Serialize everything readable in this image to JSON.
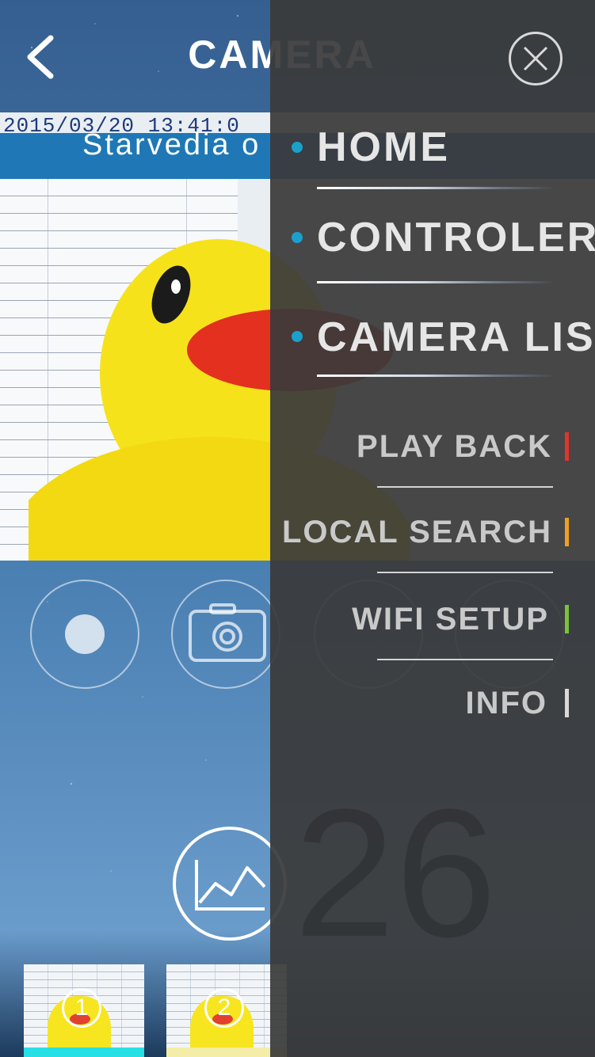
{
  "header": {
    "title": "CAMERA",
    "back_icon": "chevron-left-icon"
  },
  "video": {
    "timestamp": "2015/03/20 13:41:0",
    "caption": "Starvedia o"
  },
  "controls": {
    "record_icon": "record-icon",
    "snapshot_icon": "camera-icon",
    "chart_icon": "line-chart-icon"
  },
  "thumbnails": [
    {
      "number": "1",
      "bar_color": "#27e0e6"
    },
    {
      "number": "2",
      "bar_color": "#f3eda8"
    }
  ],
  "drawer": {
    "close_icon": "close-icon",
    "accent_color": "#1ba0cc",
    "main_items": [
      {
        "label": "HOME"
      },
      {
        "label": "CONTROLER"
      },
      {
        "label": "CAMERA LIST"
      }
    ],
    "sub_items": [
      {
        "label": "PLAY BACK",
        "marker_color": "#e0352b"
      },
      {
        "label": "LOCAL SEARCH",
        "marker_color": "#f0a020"
      },
      {
        "label": "WIFI SETUP",
        "marker_color": "#7cc23a"
      },
      {
        "label": "INFO",
        "marker_color": "#d9d9d9"
      }
    ]
  }
}
